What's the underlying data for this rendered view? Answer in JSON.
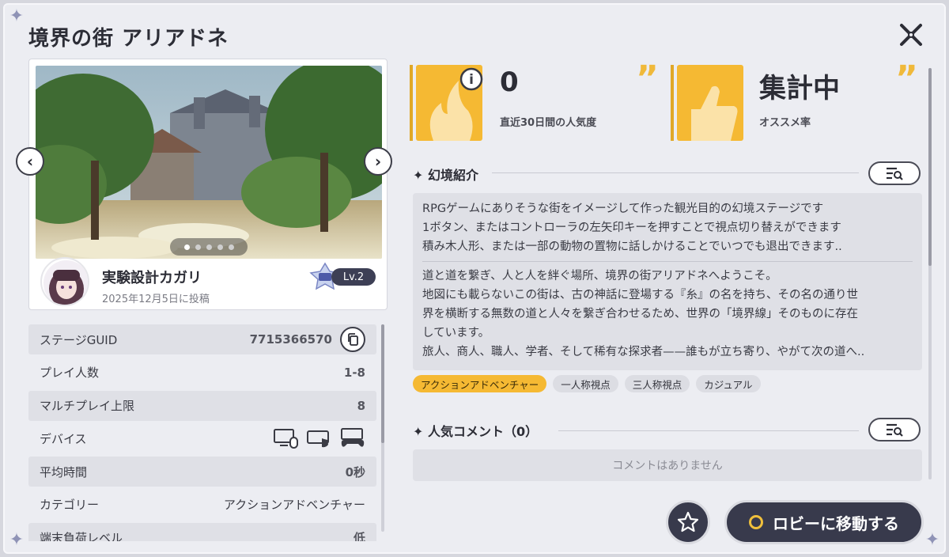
{
  "window": {
    "title": "境界の街 アリアドネ"
  },
  "card": {
    "author": "実験設計カガリ",
    "posted": "2025年12月5日に投稿",
    "level": "Lv.2",
    "carousel": {
      "count": 5,
      "active": 0
    }
  },
  "info": {
    "rows": [
      {
        "label": "ステージGUID",
        "value": "7715366570"
      },
      {
        "label": "プレイ人数",
        "value": "1-8"
      },
      {
        "label": "マルチプレイ上限",
        "value": "8"
      },
      {
        "label": "デバイス",
        "value": ""
      },
      {
        "label": "平均時間",
        "value": "0秒"
      },
      {
        "label": "カテゴリー",
        "value": "アクションアドベンチャー"
      },
      {
        "label": "端末負荷レベル",
        "value": "低"
      }
    ],
    "devices": [
      "pc-mouse-icon",
      "mobile-touch-icon",
      "gamepad-icon"
    ]
  },
  "stats": {
    "popularity": {
      "value": "0",
      "label": "直近30日間の人気度"
    },
    "recommend": {
      "value": "集計中",
      "label": "オススメ率"
    }
  },
  "intro": {
    "title": "幻境紹介",
    "lines_a": [
      "RPGゲームにありそうな街をイメージして作った観光目的の幻境ステージです",
      "1ボタン、またはコントローラの左矢印キーを押すことで視点切り替えができます",
      "積み木人形、または一部の動物の置物に話しかけることでいつでも退出できます.."
    ],
    "lines_b": [
      "道と道を繋ぎ、人と人を絆ぐ場所、境界の街アリアドネへようこそ。",
      "地図にも載らないこの街は、古の神話に登場する『糸』の名を持ち、その名の通り世",
      "界を横断する無数の道と人々を繋ぎ合わせるため、世界の「境界線」そのものに存在",
      "しています。",
      "旅人、商人、職人、学者、そして稀有な探求者——誰もが立ち寄り、やがて次の道へ.."
    ]
  },
  "tags": [
    "アクションアドベンチャー",
    "一人称視点",
    "三人称視点",
    "カジュアル"
  ],
  "comments": {
    "title": "人気コメント（0）",
    "empty": "コメントはありません"
  },
  "actions": {
    "lobby": "ロビーに移動する"
  },
  "colors": {
    "accent": "#f5b933",
    "button_dark": "#383a4c",
    "panel": "#ecedf2"
  }
}
